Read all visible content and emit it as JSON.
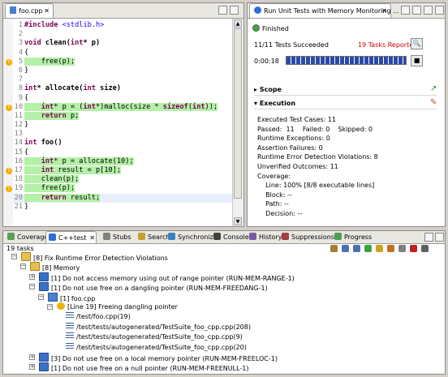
{
  "editor": {
    "tab": "foo.cpp",
    "lines": [
      {
        "n": "1",
        "segs": [
          {
            "t": "#include ",
            "k": "kw"
          },
          {
            "t": "<stdlib.h>",
            "k": "str"
          }
        ],
        "hl": false,
        "warn": false
      },
      {
        "n": "2",
        "segs": [],
        "hl": false,
        "warn": false
      },
      {
        "n": "3",
        "segs": [
          {
            "t": "void ",
            "k": "kw"
          },
          {
            "t": "clean(",
            "k": "b"
          },
          {
            "t": "int",
            "k": "kw"
          },
          {
            "t": "* p)",
            "k": "b"
          }
        ],
        "hl": false,
        "warn": false
      },
      {
        "n": "4",
        "segs": [
          {
            "t": "{",
            "k": ""
          }
        ],
        "hl": false,
        "warn": false
      },
      {
        "n": "5",
        "segs": [
          {
            "t": "    free(p);",
            "k": ""
          }
        ],
        "hl": true,
        "warn": true
      },
      {
        "n": "6",
        "segs": [
          {
            "t": "}",
            "k": ""
          }
        ],
        "hl": false,
        "warn": false
      },
      {
        "n": "7",
        "segs": [],
        "hl": false,
        "warn": false
      },
      {
        "n": "8",
        "segs": [
          {
            "t": "int",
            "k": "kw"
          },
          {
            "t": "* allocate(",
            "k": "b"
          },
          {
            "t": "int",
            "k": "kw"
          },
          {
            "t": " size)",
            "k": "b"
          }
        ],
        "hl": false,
        "warn": false
      },
      {
        "n": "9",
        "segs": [
          {
            "t": "{",
            "k": ""
          }
        ],
        "hl": false,
        "warn": false
      },
      {
        "n": "10",
        "segs": [
          {
            "t": "    ",
            "k": ""
          },
          {
            "t": "int",
            "k": "kw"
          },
          {
            "t": "* p = (",
            "k": ""
          },
          {
            "t": "int",
            "k": "kw"
          },
          {
            "t": "*)malloc(size * ",
            "k": ""
          },
          {
            "t": "sizeof",
            "k": "kw"
          },
          {
            "t": "(",
            "k": ""
          },
          {
            "t": "int",
            "k": "kw"
          },
          {
            "t": "));",
            "k": ""
          }
        ],
        "hl": true,
        "warn": true
      },
      {
        "n": "11",
        "segs": [
          {
            "t": "    ",
            "k": ""
          },
          {
            "t": "return",
            "k": "kw"
          },
          {
            "t": " p;",
            "k": ""
          }
        ],
        "hl": true,
        "warn": false
      },
      {
        "n": "12",
        "segs": [
          {
            "t": "}",
            "k": ""
          }
        ],
        "hl": false,
        "warn": false
      },
      {
        "n": "13",
        "segs": [],
        "hl": false,
        "warn": false
      },
      {
        "n": "14",
        "segs": [
          {
            "t": "int ",
            "k": "kw"
          },
          {
            "t": "foo()",
            "k": "b"
          }
        ],
        "hl": false,
        "warn": false
      },
      {
        "n": "15",
        "segs": [
          {
            "t": "{",
            "k": ""
          }
        ],
        "hl": false,
        "warn": false
      },
      {
        "n": "16",
        "segs": [
          {
            "t": "    ",
            "k": ""
          },
          {
            "t": "int",
            "k": "kw"
          },
          {
            "t": "* p = allocate(10);",
            "k": ""
          }
        ],
        "hl": true,
        "warn": false
      },
      {
        "n": "17",
        "segs": [
          {
            "t": "    ",
            "k": ""
          },
          {
            "t": "int",
            "k": "kw"
          },
          {
            "t": " result = p[10];",
            "k": ""
          }
        ],
        "hl": true,
        "warn": true
      },
      {
        "n": "18",
        "segs": [
          {
            "t": "    clean(p);",
            "k": ""
          }
        ],
        "hl": true,
        "warn": false
      },
      {
        "n": "19",
        "segs": [
          {
            "t": "    free(p);",
            "k": ""
          }
        ],
        "hl": true,
        "warn": true
      },
      {
        "n": "20",
        "segs": [
          {
            "t": "    ",
            "k": ""
          },
          {
            "t": "return",
            "k": "kw"
          },
          {
            "t": " result;",
            "k": ""
          }
        ],
        "hl": true,
        "warn": false,
        "cur": true
      },
      {
        "n": "21",
        "segs": [
          {
            "t": "}",
            "k": ""
          }
        ],
        "hl": false,
        "warn": false
      }
    ]
  },
  "tests": {
    "tab": "Run Unit Tests with Memory Monitoring ...",
    "status": "Finished",
    "summary": "11/11 Tests Succeeded",
    "tasks": "19 Tasks Reported",
    "time": "0:00:18",
    "progress": 1.0,
    "scope_label": "Scope",
    "execution_label": "Execution",
    "exec_lines": [
      "Executed Test Cases: 11",
      "Passed:  11    Failed: 0    Skipped: 0",
      "Runtime Exceptions: 0",
      "Assertion Failures: 0",
      "Runtime Error Detection Violations: 8",
      "Unverified Outcomes: 11",
      "Coverage:",
      "    Line: 100% [8/8 executable lines]",
      "    Block: --",
      "    Path: --",
      "    Decision: --"
    ]
  },
  "bottom": {
    "tabs": [
      "Coverage",
      "C++test",
      "Stubs",
      "Search",
      "Synchronize",
      "Console",
      "History",
      "Suppressions",
      "Progress"
    ],
    "task_count": "19 tasks",
    "tree": [
      {
        "text": "[8] Fix Runtime Error Detection Violations",
        "lvl": 0,
        "pm": "-",
        "icon": "folder"
      },
      {
        "text": "[8] Memory",
        "lvl": 1,
        "pm": "-",
        "icon": "folder"
      },
      {
        "text": "[1] Do not access memory using out of range pointer (RUN-MEM-RANGE-1)",
        "lvl": 2,
        "pm": "+",
        "icon": "rule"
      },
      {
        "text": "[1] Do not use free on a dangling pointer (RUN-MEM-FREEDANG-1)",
        "lvl": 2,
        "pm": "-",
        "icon": "rule"
      },
      {
        "text": "[1] foo.cpp",
        "lvl": 3,
        "pm": "-",
        "icon": "file"
      },
      {
        "text": "[Line 19] Freeing dangling pointer",
        "lvl": 4,
        "pm": "-",
        "icon": "warn"
      },
      {
        "text": "/test/foo.cpp(19)",
        "lvl": 5,
        "pm": "",
        "icon": "stack"
      },
      {
        "text": "/test/tests/autogenerated/TestSuite_foo_cpp.cpp(208)",
        "lvl": 5,
        "pm": "",
        "icon": "stack"
      },
      {
        "text": "/test/tests/autogenerated/TestSuite_foo_cpp.cpp(9)",
        "lvl": 5,
        "pm": "",
        "icon": "stack"
      },
      {
        "text": "/test/tests/autogenerated/TestSuite_foo_cpp.cpp(20)",
        "lvl": 5,
        "pm": "",
        "icon": "stack"
      },
      {
        "text": "[3] Do not use free on a local memory pointer (RUN-MEM-FREELOC-1)",
        "lvl": 2,
        "pm": "+",
        "icon": "rule"
      },
      {
        "text": "[1] Do not use free on a null pointer (RUN-MEM-FREENULL-1)",
        "lvl": 2,
        "pm": "+",
        "icon": "rule"
      }
    ]
  },
  "colors": {
    "highlight": "#b5f0a8",
    "progress": "#2b4aa5",
    "tasks": "#cc0000"
  }
}
